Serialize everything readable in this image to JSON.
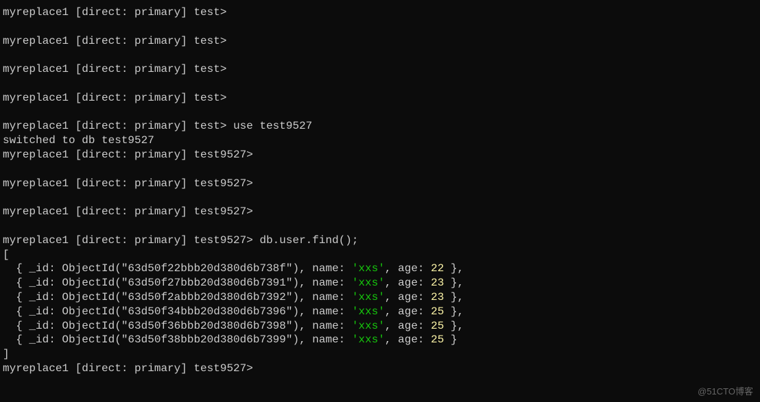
{
  "prompts": {
    "test": "myreplace1 [direct: primary] test>",
    "test9527": "myreplace1 [direct: primary] test9527>"
  },
  "commands": {
    "use": "use test9527",
    "find": "db.user.find();"
  },
  "messages": {
    "switched": "switched to db test9527"
  },
  "records": [
    {
      "id": "63d50f22bbb20d380d6b738f",
      "name": "xxs",
      "age": 22
    },
    {
      "id": "63d50f27bbb20d380d6b7391",
      "name": "xxs",
      "age": 23
    },
    {
      "id": "63d50f2abbb20d380d6b7392",
      "name": "xxs",
      "age": 23
    },
    {
      "id": "63d50f34bbb20d380d6b7396",
      "name": "xxs",
      "age": 25
    },
    {
      "id": "63d50f36bbb20d380d6b7398",
      "name": "xxs",
      "age": 25
    },
    {
      "id": "63d50f38bbb20d380d6b7399",
      "name": "xxs",
      "age": 25
    }
  ],
  "syntax": {
    "open_bracket": "[",
    "close_bracket": "]",
    "doc_prefix": "  { _id: ObjectId(\"",
    "doc_mid1": "\"), name: ",
    "quote": "'",
    "doc_mid2": ", age: ",
    "doc_suffix_comma": " },",
    "doc_suffix_last": " }"
  },
  "watermark": "@51CTO博客"
}
